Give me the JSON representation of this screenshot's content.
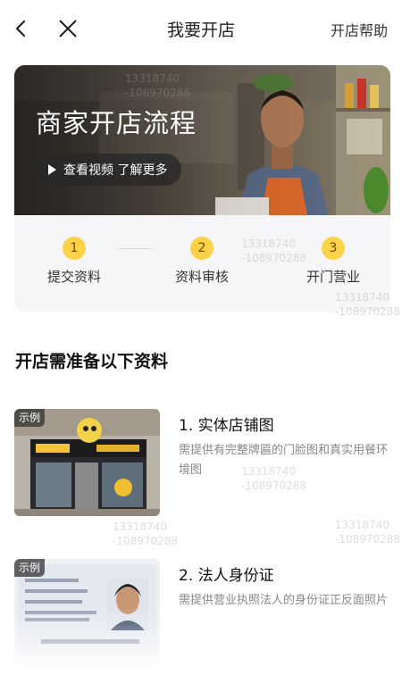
{
  "nav": {
    "title": "我要开店",
    "help": "开店帮助",
    "back_icon": "back-arrow-icon",
    "close_icon": "close-icon"
  },
  "banner": {
    "title": "商家开店流程",
    "video_button": "查看视频 了解更多"
  },
  "steps": [
    {
      "num": "1",
      "label": "提交资料"
    },
    {
      "num": "2",
      "label": "资料审核"
    },
    {
      "num": "3",
      "label": "开门营业"
    }
  ],
  "section_title": "开店需准备以下资料",
  "materials": [
    {
      "badge": "示例",
      "title": "1. 实体店铺图",
      "desc": "需提供有完整牌匾的门脸图和真实用餐环境图"
    },
    {
      "badge": "示例",
      "title": "2. 法人身份证",
      "desc": "需提供营业执照法人的身份证正反面照片"
    }
  ],
  "watermark": {
    "line1": "13318740",
    "line2": "-108970288"
  },
  "colors": {
    "accent": "#fcd249",
    "card_bg": "#f6f6f8"
  }
}
